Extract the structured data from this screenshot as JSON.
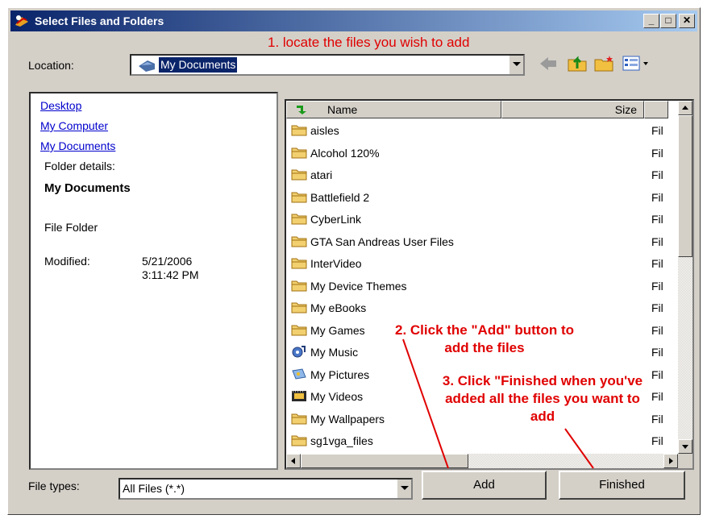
{
  "window": {
    "title": "Select Files and Folders"
  },
  "annotations": {
    "step1": "1. locate the files you wish to add",
    "step2": "2. Click the \"Add\" button to add the files",
    "step3": "3. Click \"Finished when you've added all the files you want to add"
  },
  "location": {
    "label": "Location:",
    "value": "My Documents"
  },
  "sidebar": {
    "links": [
      "Desktop",
      "My Computer",
      "My Documents"
    ],
    "details_label": "Folder details:",
    "folder_name": "My Documents",
    "folder_type": "File Folder",
    "modified_label": "Modified:",
    "modified_date": "5/21/2006",
    "modified_time": "3:11:42 PM"
  },
  "list": {
    "columns": [
      "Name",
      "Size"
    ],
    "rows": [
      {
        "name": "aisles",
        "type": "Fil",
        "icon": "folder"
      },
      {
        "name": "Alcohol 120%",
        "type": "Fil",
        "icon": "folder"
      },
      {
        "name": "atari",
        "type": "Fil",
        "icon": "folder"
      },
      {
        "name": "Battlefield 2",
        "type": "Fil",
        "icon": "folder"
      },
      {
        "name": "CyberLink",
        "type": "Fil",
        "icon": "folder"
      },
      {
        "name": "GTA San Andreas User Files",
        "type": "Fil",
        "icon": "folder"
      },
      {
        "name": "InterVideo",
        "type": "Fil",
        "icon": "folder"
      },
      {
        "name": "My Device Themes",
        "type": "Fil",
        "icon": "folder"
      },
      {
        "name": "My eBooks",
        "type": "Fil",
        "icon": "folder"
      },
      {
        "name": "My Games",
        "type": "Fil",
        "icon": "folder"
      },
      {
        "name": "My Music",
        "type": "Fil",
        "icon": "music-folder"
      },
      {
        "name": "My Pictures",
        "type": "Fil",
        "icon": "pictures-folder"
      },
      {
        "name": "My Videos",
        "type": "Fil",
        "icon": "videos-folder"
      },
      {
        "name": "My Wallpapers",
        "type": "Fil",
        "icon": "folder"
      },
      {
        "name": "sg1vga_files",
        "type": "Fil",
        "icon": "folder"
      }
    ]
  },
  "filetypes": {
    "label": "File types:",
    "value": "All Files (*.*)"
  },
  "buttons": {
    "add": "Add",
    "finished": "Finished"
  },
  "colors": {
    "annotation": "#e00000",
    "titlebar": "#0a246a",
    "selection": "#0a246a"
  }
}
